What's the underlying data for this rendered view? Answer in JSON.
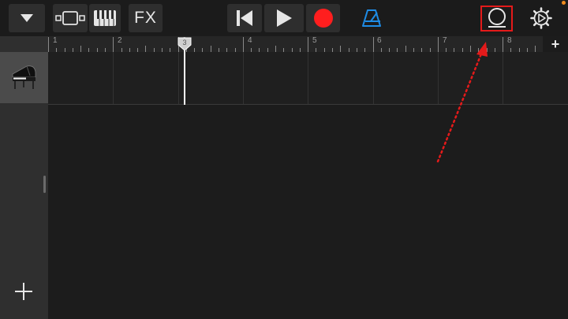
{
  "toolbar": {
    "fx_label": "FX",
    "icons": {
      "menu": "triangle-down-icon",
      "tracks_view": "tracks-view-icon",
      "keyboard": "keyboard-icon",
      "rewind": "skip-to-start-icon",
      "play": "play-icon",
      "record": "record-icon",
      "metronome": "metronome-icon",
      "loop_browser": "loop-browser-icon",
      "settings": "gear-icon"
    },
    "colors": {
      "record": "#ff1e1e",
      "metronome": "#1e8ce6",
      "highlight": "#e41a1a",
      "notification_dot": "#f08a1c"
    }
  },
  "ruler": {
    "bar_numbers": [
      "1",
      "2",
      "3",
      "4",
      "5",
      "6",
      "7",
      "8"
    ],
    "add_track_label": "+"
  },
  "tracks": [
    {
      "instrument_icon": "grand-piano-icon"
    }
  ],
  "sidebar": {
    "add_label": "+"
  },
  "playhead": {
    "bar": "3"
  }
}
